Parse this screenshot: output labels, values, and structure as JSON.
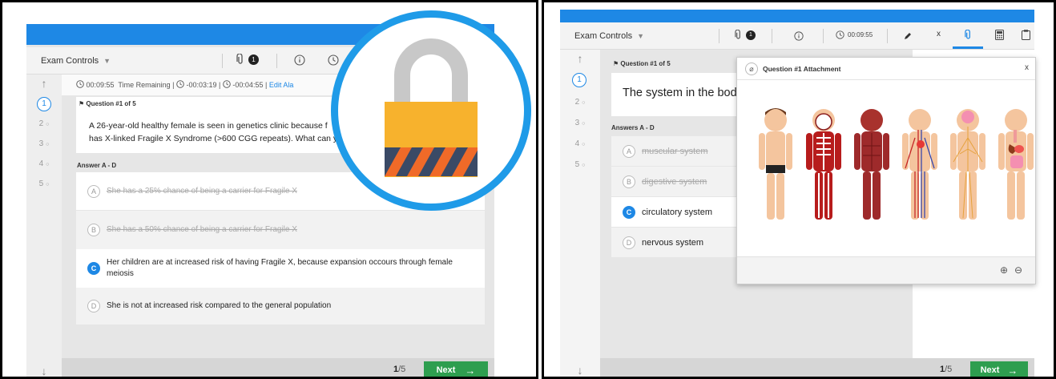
{
  "left": {
    "exam_controls": "Exam Controls",
    "attachments_count": "1",
    "timer": {
      "elapsed": "00:09:55",
      "remaining_label": "Time Remaining",
      "sep1": "|",
      "t1": "-00:03:19",
      "sep2": "|",
      "t2": "-00:04:55",
      "sep3": "|",
      "edit": "Edit Ala"
    },
    "sidebar": [
      "1",
      "2",
      "3",
      "4",
      "5"
    ],
    "question_label": "Question #1 of 5",
    "question_line1": "A 26-year-old healthy female is seen in genetics clinic because f",
    "question_line2": "has X-linked Fragile X Syndrome (>600 CGG repeats). What can y",
    "answers_label": "Answer A - D",
    "answers": [
      {
        "letter": "A",
        "text": "She has a 25% chance of being a carrier for Fragile X"
      },
      {
        "letter": "B",
        "text": "She has a 50% chance of being a carrier for Fragile X"
      },
      {
        "letter": "C",
        "text": "Her children are at increased risk of having Fragile X, because expansion occours through female meiosis"
      },
      {
        "letter": "D",
        "text": "She is not at increased risk compared to the general population"
      }
    ],
    "pager_current": "1",
    "pager_total": "/5",
    "next": "Next"
  },
  "right": {
    "exam_controls": "Exam Controls",
    "attachments_count": "1",
    "timer": "00:09:55",
    "close_x": "x",
    "sidebar": [
      "1",
      "2",
      "3",
      "4",
      "5"
    ],
    "question_label": "Question #1 of 5",
    "question_text": "The system in the bod",
    "answers_label": "Answers A - D",
    "answers": [
      {
        "letter": "A",
        "text": "muscular system"
      },
      {
        "letter": "B",
        "text": "digestive system"
      },
      {
        "letter": "C",
        "text": "circulatory system"
      },
      {
        "letter": "D",
        "text": "nervous system"
      }
    ],
    "attachment_title": "Question #1 Attachment",
    "attachment_close": "x",
    "pager_current": "1",
    "pager_total": "/5",
    "next": "Next"
  },
  "colors": {
    "accent": "#1e88e5",
    "next_green": "#2e9e4f",
    "lock_body": "#f7b22d",
    "lock_shackle": "#c8c8c8",
    "stripe_dark": "#3a4a66",
    "stripe_orange": "#f06a28"
  },
  "icons": [
    "paperclip-icon",
    "info-icon",
    "clock-icon",
    "pencil-icon",
    "calculator-icon",
    "notepad-icon",
    "zoom-in-icon",
    "zoom-out-icon",
    "flag-icon",
    "arrow-up-icon",
    "arrow-down-icon",
    "arrow-right-icon",
    "lock-icon"
  ]
}
